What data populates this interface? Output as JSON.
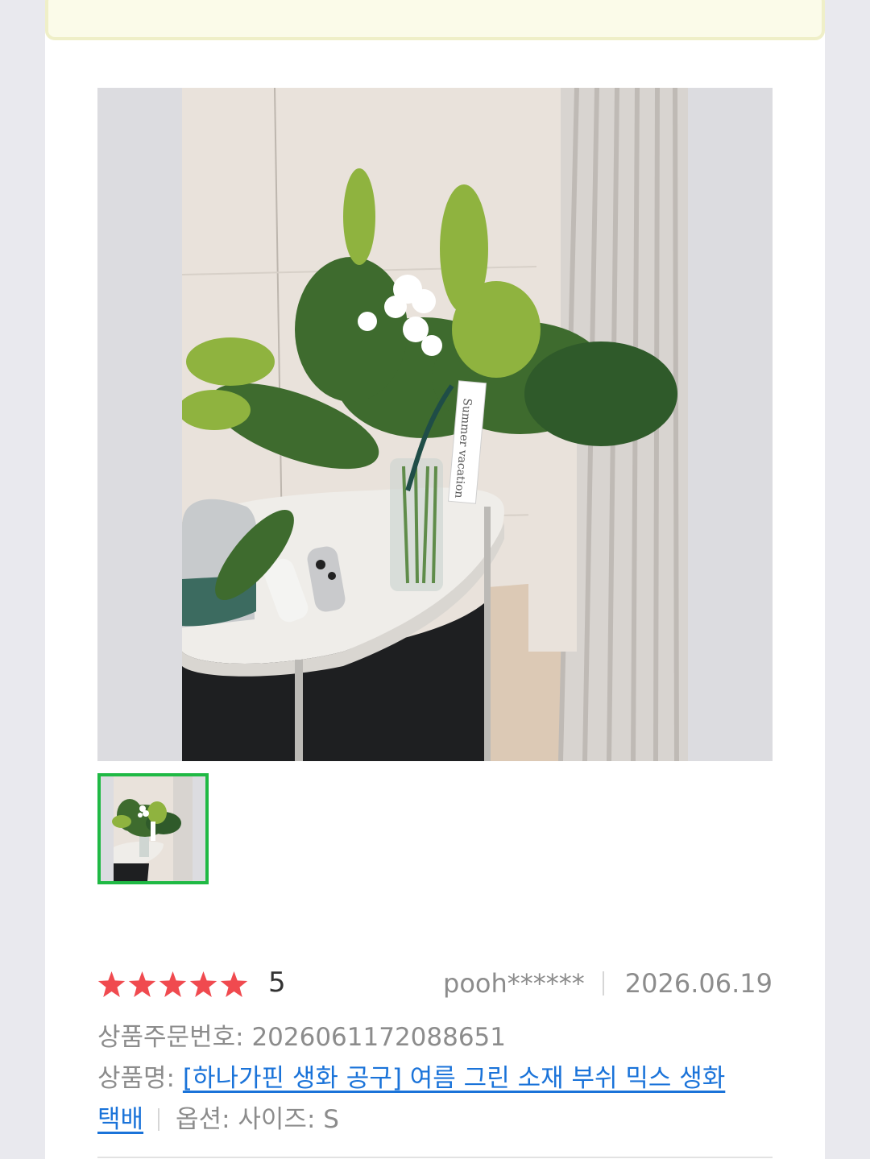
{
  "review": {
    "rating_value": "5",
    "stars_filled": 5,
    "stars_total": 5,
    "username": "pooh******",
    "date": "2026.06.19",
    "order_number_label": "상품주문번호:",
    "order_number": "2026061172088651",
    "product_label": "상품명:",
    "product_name_line1": "[하나가핀 생화 공구] 여름 그린 소재 부쉬 믹스 생화",
    "product_name_line2": "택배",
    "option_label": "옵션:",
    "option_value": "사이즈: S"
  },
  "image_tag_text": "Summer vacation",
  "colors": {
    "star": "#f04a4f",
    "link": "#1a73d9",
    "thumbnail_border": "#1fb944",
    "banner_bg": "#fbfbe9",
    "meta_text": "#8c8c8c"
  },
  "icons": {
    "star": "star-icon"
  }
}
